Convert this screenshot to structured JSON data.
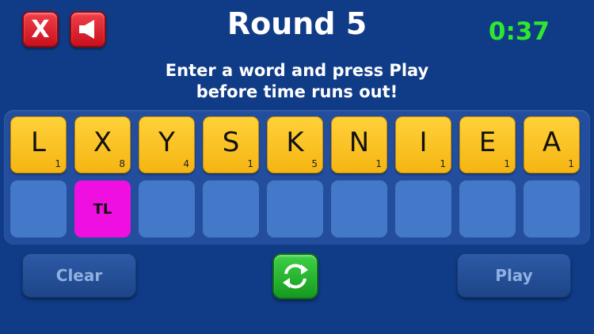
{
  "header": {
    "close_label": "X",
    "title": "Round 5",
    "timer": "0:37"
  },
  "instructions": {
    "line1": "Enter a word and press Play",
    "line2": "before time runs out!"
  },
  "tiles": [
    {
      "letter": "L",
      "points": "1"
    },
    {
      "letter": "X",
      "points": "8"
    },
    {
      "letter": "Y",
      "points": "4"
    },
    {
      "letter": "S",
      "points": "1"
    },
    {
      "letter": "K",
      "points": "5"
    },
    {
      "letter": "N",
      "points": "1"
    },
    {
      "letter": "I",
      "points": "1"
    },
    {
      "letter": "E",
      "points": "1"
    },
    {
      "letter": "A",
      "points": "1"
    }
  ],
  "slots": [
    {
      "bonus": ""
    },
    {
      "bonus": "TL"
    },
    {
      "bonus": ""
    },
    {
      "bonus": ""
    },
    {
      "bonus": ""
    },
    {
      "bonus": ""
    },
    {
      "bonus": ""
    },
    {
      "bonus": ""
    },
    {
      "bonus": ""
    }
  ],
  "buttons": {
    "clear_label": "Clear",
    "play_label": "Play",
    "shuffle_icon": "shuffle-icon"
  },
  "colors": {
    "background": "#103c87",
    "tile": "#f5b512",
    "timer": "#2ee82e",
    "triple_letter": "#ee0fe0"
  }
}
